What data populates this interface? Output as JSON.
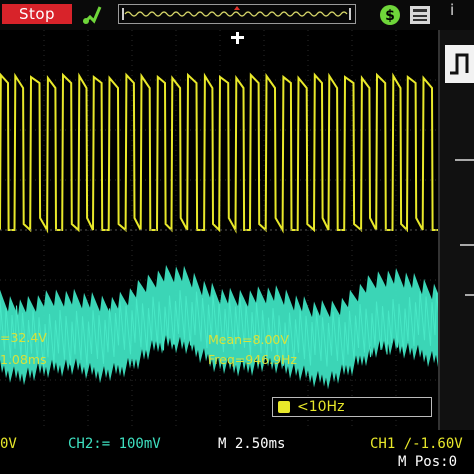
{
  "status": {
    "run_stop_label": "Stop"
  },
  "icons": {
    "probe": "probe-icon",
    "usb": "usb-icon",
    "printer": "printer-icon",
    "trigger_marker": "trigger-position-icon",
    "freq_counter": "frequency-counter-icon"
  },
  "measurements": {
    "ch1_left_a": "=32.4V",
    "ch1_left_b": "1.08ms",
    "mean": "Mean=8.00V",
    "freq": "Freq=946.9Hz"
  },
  "freq_counter": {
    "label": "<10Hz"
  },
  "bottom": {
    "ch1_scale": "0V",
    "ch2_scale": "CH2:= 100mV",
    "timebase": "M 2.50ms",
    "trigger": "CH1 ∕-1.60V",
    "position": "M Pos:0"
  },
  "colors": {
    "ch1": "#e8e82a",
    "ch2": "#3ee0c0",
    "stop": "#d8232a",
    "grid": "#2a2a2a"
  }
}
